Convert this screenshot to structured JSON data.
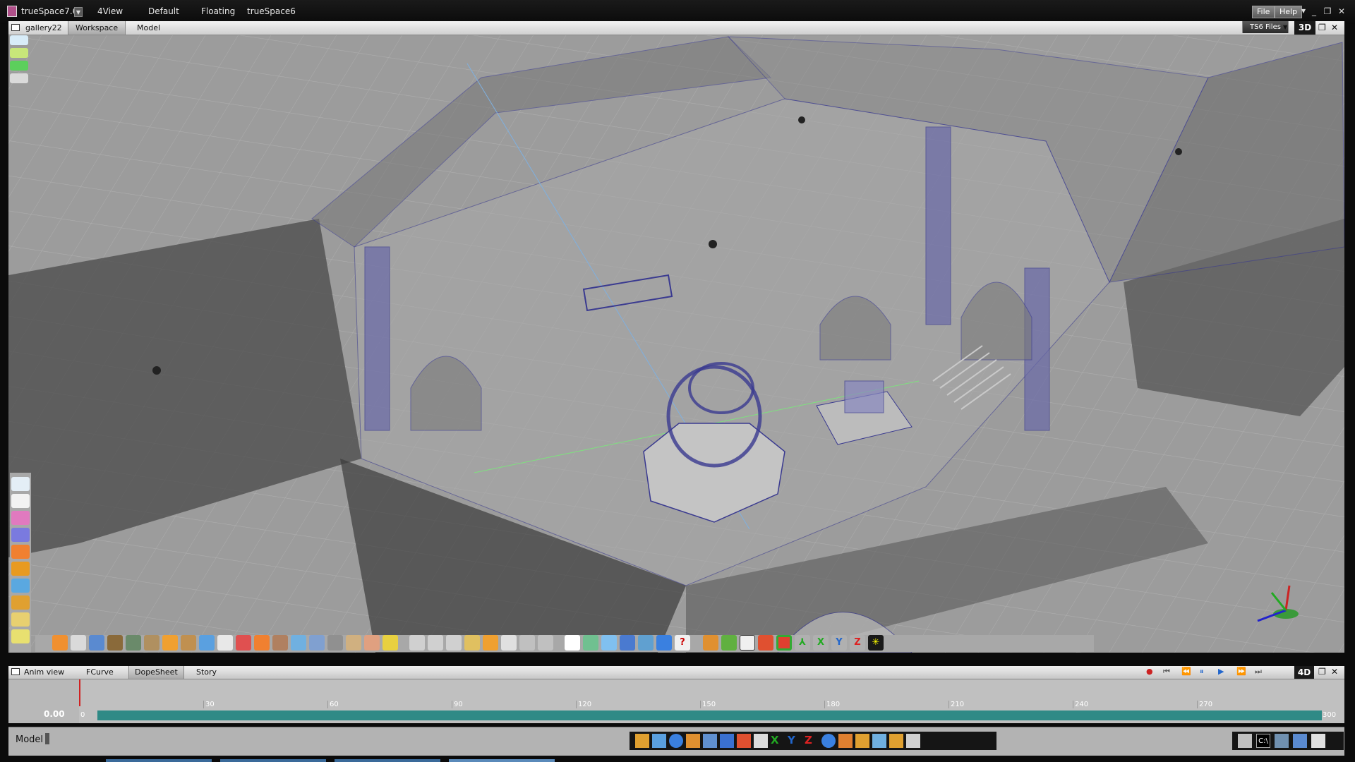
{
  "titlebar": {
    "app_title": "trueSpace7.6",
    "layouts": [
      "4View",
      "Default",
      "Floating",
      "trueSpace6"
    ],
    "menu": [
      "File",
      "Help"
    ]
  },
  "workspace_bar": {
    "scene_name": "gallery22",
    "tabs": [
      "Workspace",
      "Model"
    ],
    "ts6_files": "TS6 Files",
    "view_mode": "3D"
  },
  "anim_bar": {
    "title": "Anim view",
    "tabs": [
      "FCurve",
      "DopeSheet",
      "Story"
    ],
    "mode": "4D"
  },
  "timeline": {
    "current_time": "0.00",
    "start": "0",
    "end": "300",
    "ticks": [
      "30",
      "60",
      "90",
      "120",
      "150",
      "180",
      "210",
      "240",
      "270"
    ],
    "progress": 1.0
  },
  "statusbar": {
    "mode_label": "Model"
  },
  "colors": {
    "accent_teal": "#2f8a86",
    "viewport_bg": "#9c9c9c",
    "wire_blue": "#3a3a90"
  }
}
